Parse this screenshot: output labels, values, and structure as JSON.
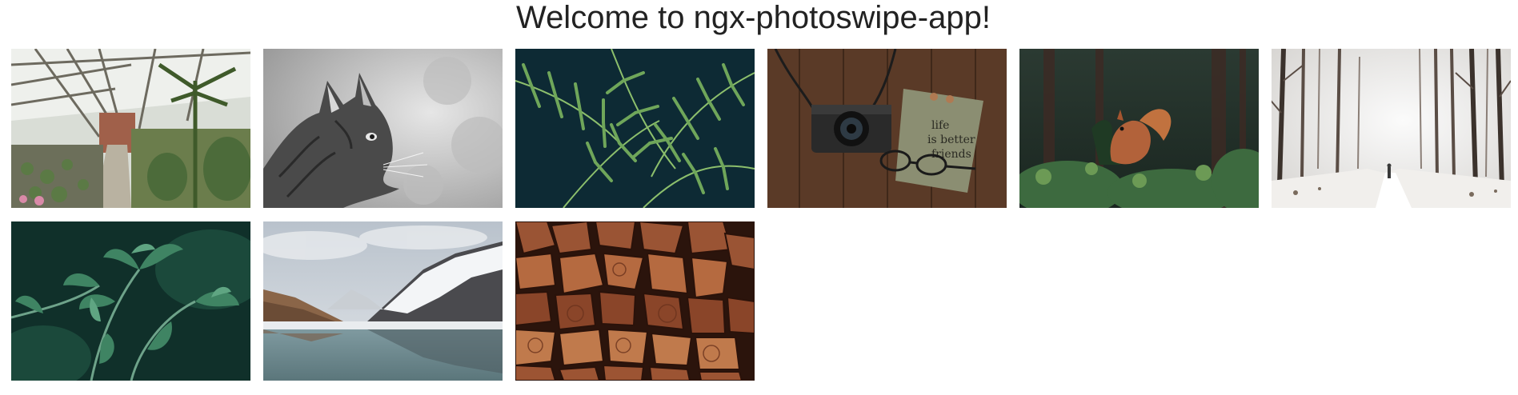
{
  "page": {
    "title": "Welcome to ngx-photoswipe-app!"
  },
  "gallery": {
    "items": [
      {
        "subject": "greenhouse",
        "colors": [
          "#e9ebe6",
          "#8c8b80",
          "#4a5b3a",
          "#b3a58c"
        ]
      },
      {
        "subject": "cat",
        "colors": [
          "#d0d0d0",
          "#7a7a7a",
          "#3a3a3a",
          "#a8a8a8"
        ]
      },
      {
        "subject": "fern",
        "colors": [
          "#0e2a33",
          "#4f7d46",
          "#8fbf6e",
          "#1b3f36"
        ]
      },
      {
        "subject": "camera",
        "colors": [
          "#5b3b28",
          "#2a2420",
          "#8c8f72",
          "#3e2a1e"
        ]
      },
      {
        "subject": "squirrel",
        "colors": [
          "#1e2a23",
          "#3d5a3b",
          "#b5653a",
          "#4a3a30"
        ]
      },
      {
        "subject": "snowy-forest",
        "colors": [
          "#f2f2f2",
          "#d9d9d9",
          "#5a4c44",
          "#b7aea6"
        ]
      },
      {
        "subject": "parsley",
        "colors": [
          "#0f2e26",
          "#2e6b4c",
          "#4f8f6a",
          "#183d32"
        ]
      },
      {
        "subject": "mountain-lake",
        "colors": [
          "#c8ced6",
          "#8a6a4e",
          "#eef1f4",
          "#4f6266"
        ]
      },
      {
        "subject": "firewood",
        "colors": [
          "#3b1d12",
          "#8b4a2c",
          "#c27a4e",
          "#5a2c1a"
        ]
      }
    ]
  }
}
